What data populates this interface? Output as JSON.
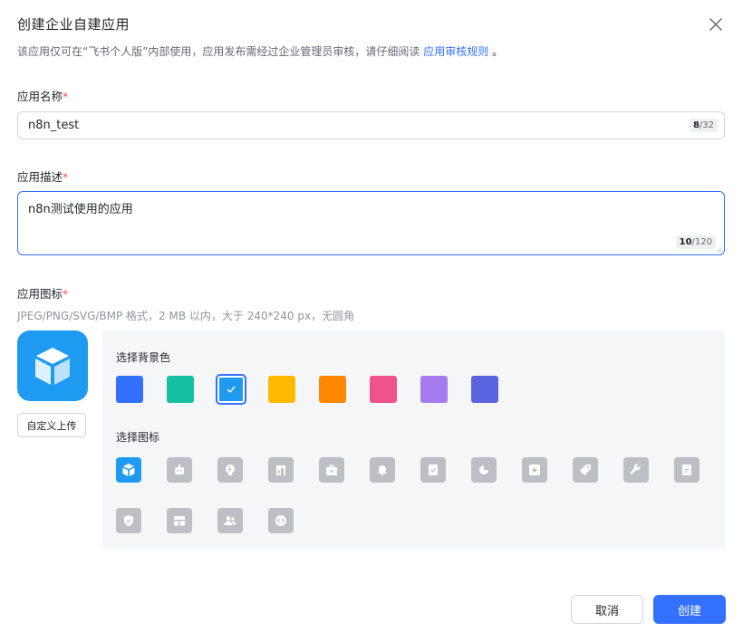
{
  "dialog": {
    "title": "创建企业自建应用",
    "subtitle_prefix": "该应用仅可在“飞书个人版”内部使用，应用发布需经过企业管理员审核，请仔细阅读",
    "subtitle_link": "应用审核规则",
    "subtitle_suffix": "。"
  },
  "name_field": {
    "label": "应用名称",
    "required_mark": "*",
    "value": "n8n_test",
    "count": "8",
    "max": "/32"
  },
  "desc_field": {
    "label": "应用描述",
    "required_mark": "*",
    "value": "n8n测试使用的应用",
    "count": "10",
    "max": "/120"
  },
  "icon_field": {
    "label": "应用图标",
    "required_mark": "*",
    "hint": "JPEG/PNG/SVG/BMP 格式，2 MB 以内，大于 240*240 px，无圆角",
    "upload_label": "自定义上传",
    "preview_icon": "cube-icon",
    "preview_color": "#1e9bf0"
  },
  "bg_colors": {
    "label": "选择背景色",
    "selected_index": 2,
    "colors": [
      "#3370ff",
      "#14c0a0",
      "#1e9bf0",
      "#ffba00",
      "#ff8800",
      "#f0528b",
      "#a77bef",
      "#5a63e0"
    ]
  },
  "icons": {
    "label": "选择图标",
    "selected_index": 0,
    "names": [
      "cube-icon",
      "robot-icon",
      "lightbulb-icon",
      "building-icon",
      "briefcase-icon",
      "bell-icon",
      "bookmark-check-icon",
      "pie-chart-icon",
      "star-icon",
      "tag-icon",
      "wrench-icon",
      "document-icon",
      "shield-check-icon",
      "layout-icon",
      "users-icon",
      "code-icon"
    ]
  },
  "footer": {
    "cancel_label": "取消",
    "create_label": "创建"
  }
}
